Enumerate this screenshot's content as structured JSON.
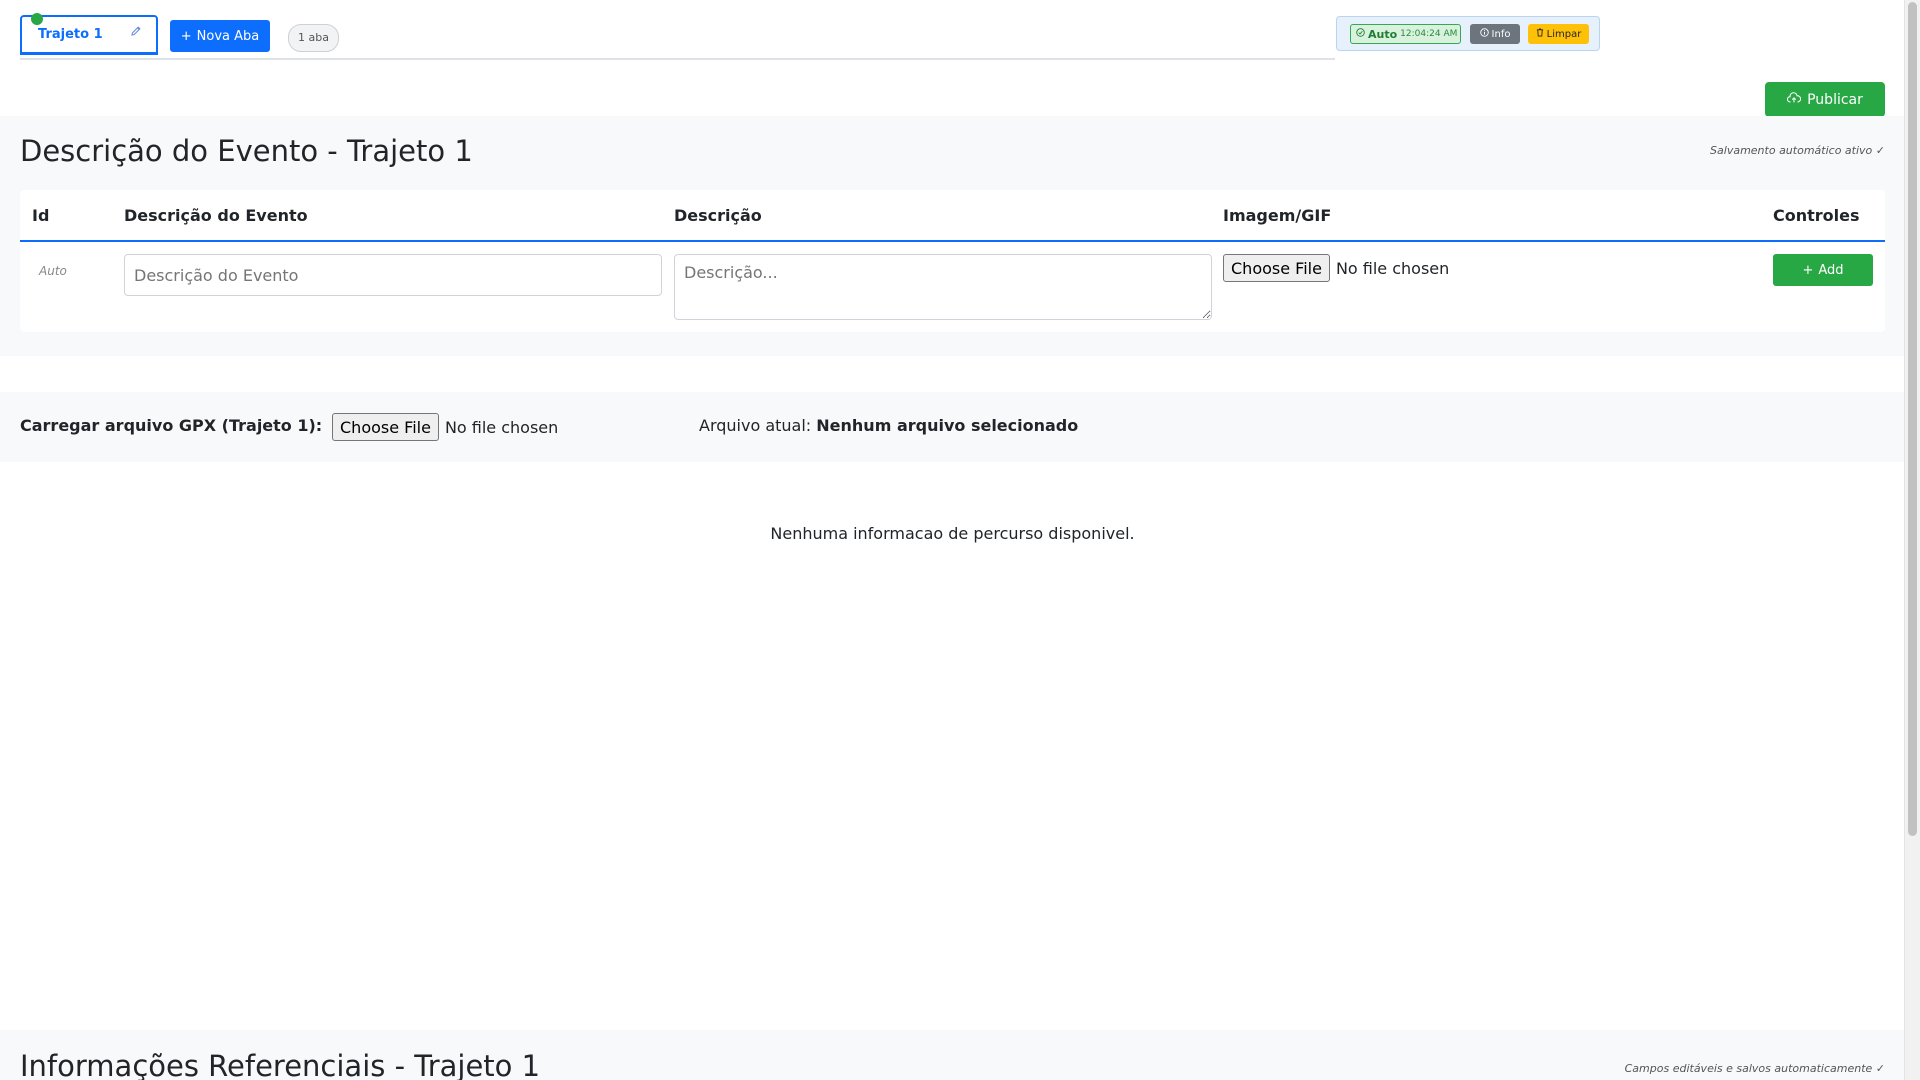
{
  "tabs": {
    "active_label": "Trajeto 1",
    "edit_icon": "pencil-icon",
    "new_tab_label": "Nova Aba",
    "count_label": "1 aba"
  },
  "status": {
    "auto_label": "Auto",
    "auto_time": "12:04:24 AM",
    "info_label": "Info",
    "clear_label": "Limpar"
  },
  "publish_label": "Publicar",
  "event_section": {
    "title": "Descrição do Evento - Trajeto 1",
    "autosave_note": "Salvamento automático ativo ✓",
    "columns": [
      "Id",
      "Descrição do Evento",
      "Descrição",
      "Imagem/GIF",
      "Controles"
    ],
    "row": {
      "id_text": "Auto",
      "event_placeholder": "Descrição do Evento",
      "description_placeholder": "Descrição...",
      "file_button": "Choose File",
      "file_status": "No file chosen",
      "add_label": "Add"
    }
  },
  "gpx": {
    "label": "Carregar arquivo GPX (Trajeto 1):",
    "file_button": "Choose File",
    "file_status": "No file chosen",
    "current_label": "Arquivo atual:",
    "current_value": "Nenhum arquivo selecionado"
  },
  "no_route_message": "Nenhuma informacao de percurso disponivel.",
  "ref_section": {
    "title": "Informações Referenciais - Trajeto 1",
    "note": "Campos editáveis e salvos automaticamente ✓"
  },
  "colors": {
    "primary": "#0d6efd",
    "success": "#28a745",
    "warning": "#ffc107",
    "secondary": "#6c757d"
  }
}
